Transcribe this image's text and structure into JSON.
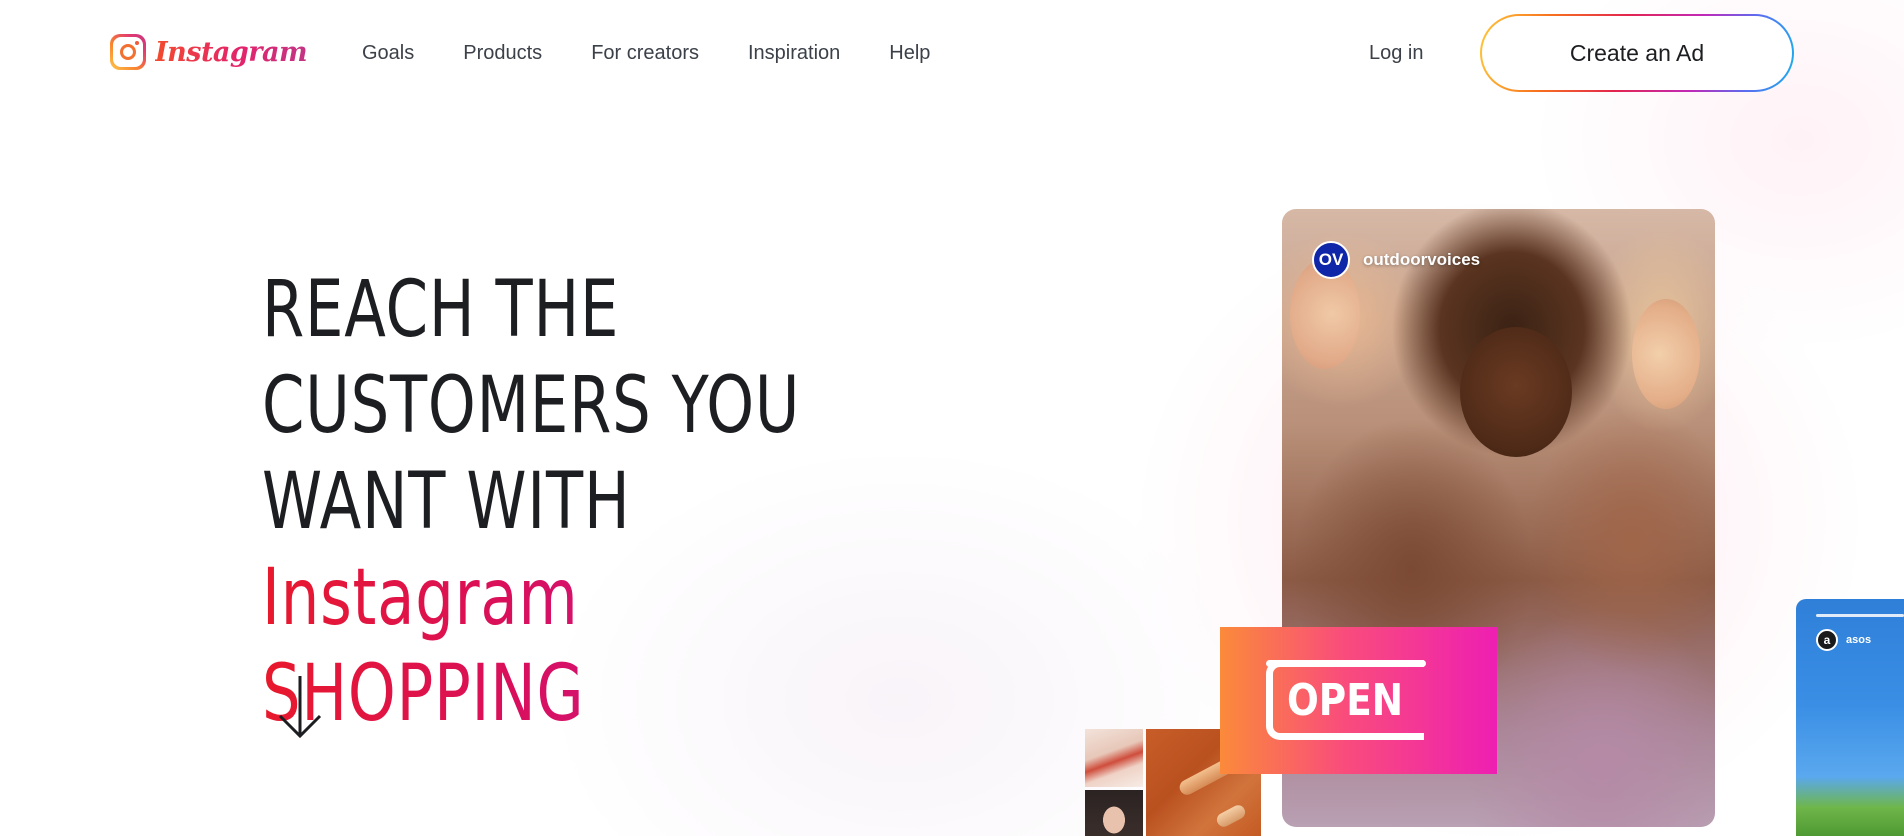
{
  "brand": {
    "logo_text": "Instagram",
    "logo_icon": "instagram-camera-icon"
  },
  "nav": {
    "links": [
      "Goals",
      "Products",
      "For creators",
      "Inspiration",
      "Help"
    ],
    "login_label": "Log in",
    "cta_label": "Create an Ad"
  },
  "hero": {
    "line1": "REACH THE",
    "line2": "CUSTOMERS YOU",
    "line3": "WANT WITH",
    "line4": "Instagram",
    "line5": "SHOPPING",
    "scroll_icon": "arrow-down-icon"
  },
  "media": {
    "main_post": {
      "avatar_text": "OV",
      "account": "outdoorvoices"
    },
    "open_sign": "OPEN",
    "side_story": {
      "avatar_text": "a",
      "account": "asos"
    }
  },
  "colors": {
    "accent_gradient": [
      "#e8192c",
      "#d90f5c",
      "#c81893"
    ],
    "cta_border_gradient": [
      "#ffc83a",
      "#f7701f",
      "#e3254e",
      "#c228b7",
      "#5b6cf0",
      "#1ab0ee"
    ],
    "text": "#1c1e21",
    "nav_text": "#3c4149"
  }
}
